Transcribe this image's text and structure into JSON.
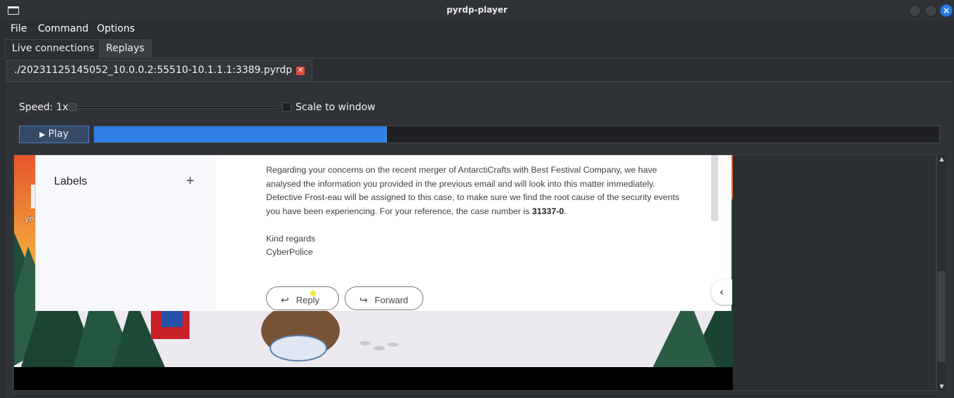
{
  "window": {
    "title": "pyrdp-player"
  },
  "menu": {
    "file": "File",
    "command": "Command",
    "options": "Options"
  },
  "tabs": {
    "live": "Live connections",
    "replays": "Replays"
  },
  "replay": {
    "file_tab_label": "./20231125145052_10.0.0.2:55510-10.1.1.1:3389.pyrdp",
    "close_glyph": "✕",
    "speed_label": "Speed: 1x",
    "speed_value": 1,
    "scale_label": "Scale to window",
    "scale_checked": false,
    "play_label": "Play",
    "play_glyph": "▶",
    "progress_fraction": 0.346
  },
  "desktop": {
    "partial_icon_label": "ye"
  },
  "email": {
    "labels_title": "Labels",
    "labels_plus": "+",
    "para_before": "Regarding your concerns on the recent merger of AntarctiCrafts with Best Festival Company, we have analysed the information you provided in the previous email and will look into this matter immediately. Detective Frost-eau will be assigned to this case, to make sure we find the root cause of the security events you have been experiencing. For your reference, the case number is ",
    "case_number": "31337-0",
    "para_after": ".",
    "regards_line1": "Kind regards",
    "regards_line2": "CyberPolice",
    "reply_label": "Reply",
    "forward_label": "Forward",
    "reply_arrow": "↩",
    "forward_arrow": "↪",
    "expand_glyph": "‹"
  },
  "scrollbar": {
    "up": "▲",
    "down": "▼"
  },
  "colors": {
    "accent": "#2f7fe6",
    "close_red": "#e04c3a",
    "window_close": "#2a7ae2"
  }
}
